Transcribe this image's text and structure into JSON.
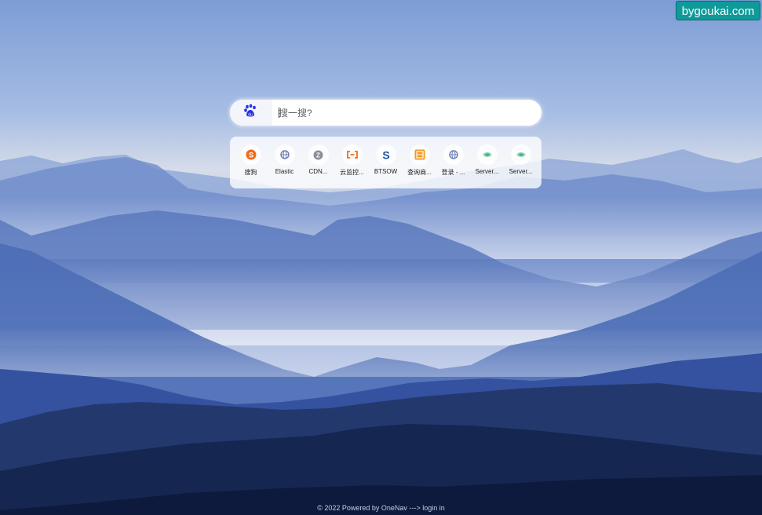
{
  "watermark": "bygoukai.com",
  "search": {
    "engine_icon": "baidu-paw-icon",
    "placeholder": "搜一搜?"
  },
  "links": [
    {
      "label": "搜狗",
      "icon": "sogou-icon",
      "color": "#f26b1d"
    },
    {
      "label": "Elastic",
      "icon": "globe-icon",
      "color": "#6b7fb0"
    },
    {
      "label": "CDN...",
      "icon": "cdn-icon",
      "color": "#8a8f99"
    },
    {
      "label": "云监控...",
      "icon": "cloud-monitor-icon",
      "color": "#f26b1d"
    },
    {
      "label": "BTSOW",
      "icon": "btsow-icon",
      "color": "#1b4f9c"
    },
    {
      "label": "查询商...",
      "icon": "query-icon",
      "color": "#f39a1e"
    },
    {
      "label": "登录 - ...",
      "icon": "globe-icon",
      "color": "#6b7fb0"
    },
    {
      "label": "Server...",
      "icon": "server-icon",
      "color": "#3db08b"
    },
    {
      "label": "Server...",
      "icon": "server-icon",
      "color": "#3db08b"
    }
  ],
  "footer": {
    "text": "© 2022 Powered by OneNav",
    "arrow": "--->",
    "login_label": "login in"
  }
}
